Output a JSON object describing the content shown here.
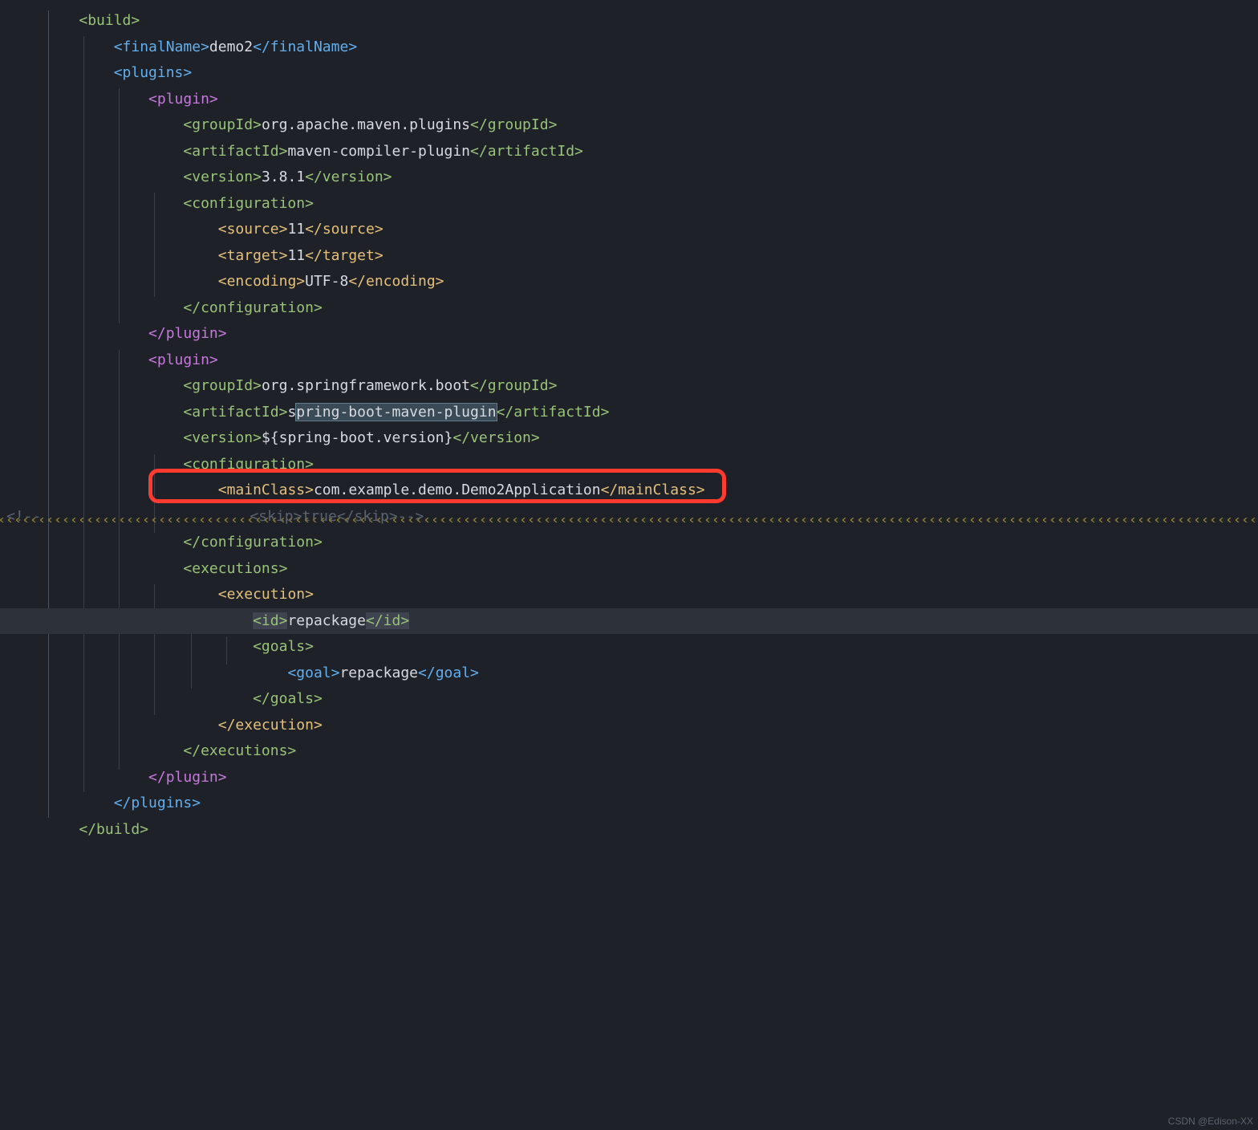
{
  "watermark": "CSDN @Edison-XX",
  "xml": {
    "build_open": "<build>",
    "finalName_open": "<finalName>",
    "finalName_val": "demo2",
    "finalName_close": "</finalName>",
    "plugins_open": "<plugins>",
    "plugin_open": "<plugin>",
    "groupId_open": "<groupId>",
    "groupId_maven": "org.apache.maven.plugins",
    "groupId_close": "</groupId>",
    "artifactId_open": "<artifactId>",
    "artifact_compiler": "maven-compiler-plugin",
    "artifactId_close": "</artifactId>",
    "version_open": "<version>",
    "version_381": "3.8.1",
    "version_close": "</version>",
    "configuration_open": "<configuration>",
    "source_open": "<source>",
    "source_val": "11",
    "source_close": "</source>",
    "target_open": "<target>",
    "target_val": "11",
    "target_close": "</target>",
    "encoding_open": "<encoding>",
    "encoding_val": "UTF-8",
    "encoding_close": "</encoding>",
    "configuration_close": "</configuration>",
    "plugin_close": "</plugin>",
    "groupId_spring": "org.springframework.boot",
    "artifact_spring_pre": "s",
    "artifact_spring_sel": "pring-boot-maven-plugin",
    "version_springboot": "${spring-boot.version}",
    "mainClass_open": "<mainClass>",
    "mainClass_val": "com.example.demo.Demo2Application",
    "mainClass_close": "</mainClass>",
    "comment_start": "<!--",
    "comment_skip": "                        <skip>true</skip>-->",
    "executions_open": "<executions>",
    "execution_open": "<execution>",
    "id_open": "<id>",
    "id_val": "repackage",
    "id_close": "</id>",
    "goals_open": "<goals>",
    "goal_open": "<goal>",
    "goal_val": "repackage",
    "goal_close": "</goal>",
    "goals_close": "</goals>",
    "execution_close": "</execution>",
    "executions_close": "</executions>",
    "plugins_close": "</plugins>",
    "build_close": "</build>"
  },
  "ind": {
    "i1": "    ",
    "i2": "        ",
    "i3": "            ",
    "i4": "                ",
    "i5": "                    ",
    "i6": "                        ",
    "i7": "                            "
  }
}
